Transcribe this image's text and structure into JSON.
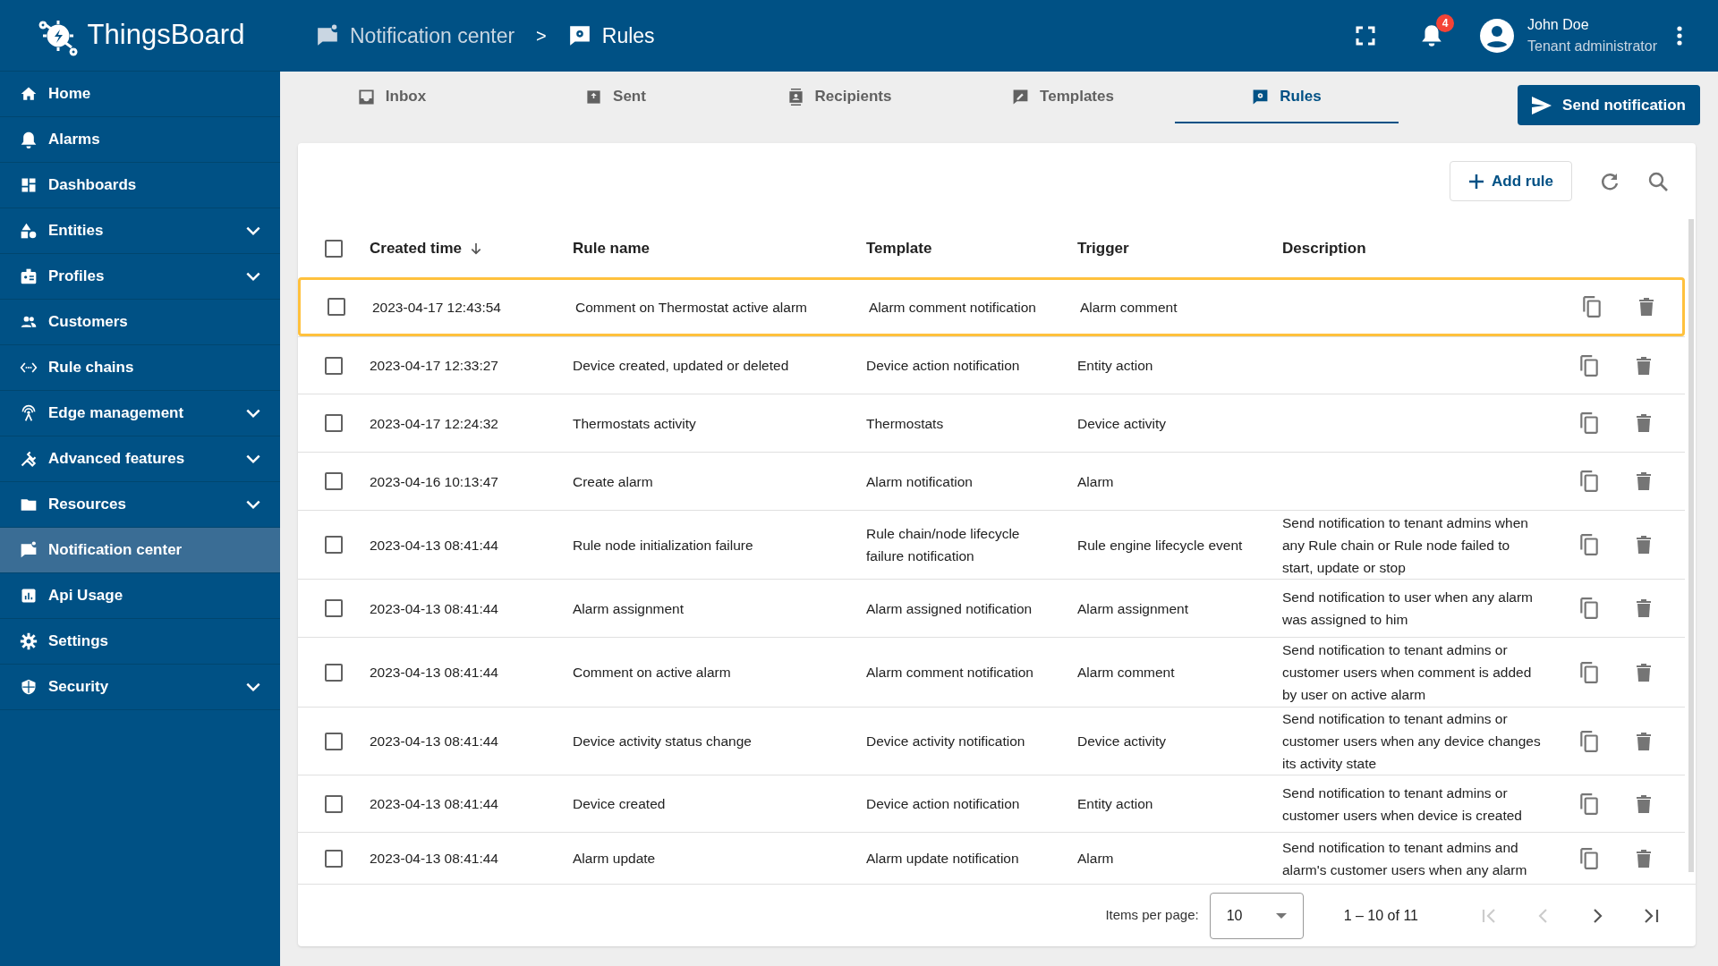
{
  "app": {
    "logo": "ThingsBoard"
  },
  "breadcrumb": [
    {
      "label": "Notification center",
      "current": false
    },
    {
      "label": "Rules",
      "current": true
    }
  ],
  "breadcrumb_separator": ">",
  "notifications": {
    "badge": "4"
  },
  "user": {
    "name": "John Doe",
    "role": "Tenant administrator"
  },
  "sidebar": {
    "items": [
      {
        "label": "Home",
        "expandable": false,
        "selected": false
      },
      {
        "label": "Alarms",
        "expandable": false,
        "selected": false
      },
      {
        "label": "Dashboards",
        "expandable": false,
        "selected": false
      },
      {
        "label": "Entities",
        "expandable": true,
        "selected": false
      },
      {
        "label": "Profiles",
        "expandable": true,
        "selected": false
      },
      {
        "label": "Customers",
        "expandable": false,
        "selected": false
      },
      {
        "label": "Rule chains",
        "expandable": false,
        "selected": false
      },
      {
        "label": "Edge management",
        "expandable": true,
        "selected": false
      },
      {
        "label": "Advanced features",
        "expandable": true,
        "selected": false
      },
      {
        "label": "Resources",
        "expandable": true,
        "selected": false
      },
      {
        "label": "Notification center",
        "expandable": false,
        "selected": true
      },
      {
        "label": "Api Usage",
        "expandable": false,
        "selected": false
      },
      {
        "label": "Settings",
        "expandable": false,
        "selected": false
      },
      {
        "label": "Security",
        "expandable": true,
        "selected": false
      }
    ]
  },
  "tabs": [
    {
      "label": "Inbox",
      "selected": false
    },
    {
      "label": "Sent",
      "selected": false
    },
    {
      "label": "Recipients",
      "selected": false
    },
    {
      "label": "Templates",
      "selected": false
    },
    {
      "label": "Rules",
      "selected": true
    }
  ],
  "send_button": "Send notification",
  "toolbar": {
    "add_button": "Add rule"
  },
  "table": {
    "select_all": {
      "checked": false
    },
    "columns": [
      "Created time",
      "Rule name",
      "Template",
      "Trigger",
      "Description"
    ],
    "rows": [
      {
        "checked": false,
        "highlighted": true,
        "cells": [
          "2023-04-17 12:43:54",
          "Comment on Thermostat active alarm",
          "Alarm comment notification",
          "Alarm comment",
          ""
        ]
      },
      {
        "checked": false,
        "highlighted": false,
        "cells": [
          "2023-04-17 12:33:27",
          "Device created, updated or deleted",
          "Device action notification",
          "Entity action",
          ""
        ]
      },
      {
        "checked": false,
        "highlighted": false,
        "cells": [
          "2023-04-17 12:24:32",
          "Thermostats activity",
          "Thermostats",
          "Device activity",
          ""
        ]
      },
      {
        "checked": false,
        "highlighted": false,
        "cells": [
          "2023-04-16 10:13:47",
          "Create alarm",
          "Alarm notification",
          "Alarm",
          ""
        ]
      },
      {
        "checked": false,
        "highlighted": false,
        "cells": [
          "2023-04-13 08:41:44",
          "Rule node initialization failure",
          "Rule chain/node lifecycle failure notification",
          "Rule engine lifecycle event",
          "Send notification to tenant admins when any Rule chain or Rule node failed to start, update or stop"
        ]
      },
      {
        "checked": false,
        "highlighted": false,
        "cells": [
          "2023-04-13 08:41:44",
          "Alarm assignment",
          "Alarm assigned notification",
          "Alarm assignment",
          "Send notification to user when any alarm was assigned to him"
        ]
      },
      {
        "checked": false,
        "highlighted": false,
        "cells": [
          "2023-04-13 08:41:44",
          "Comment on active alarm",
          "Alarm comment notification",
          "Alarm comment",
          "Send notification to tenant admins or customer users when comment is added by user on active alarm"
        ]
      },
      {
        "checked": false,
        "highlighted": false,
        "cells": [
          "2023-04-13 08:41:44",
          "Device activity status change",
          "Device activity notification",
          "Device activity",
          "Send notification to tenant admins or customer users when any device changes its activity state"
        ]
      },
      {
        "checked": false,
        "highlighted": false,
        "cells": [
          "2023-04-13 08:41:44",
          "Device created",
          "Device action notification",
          "Entity action",
          "Send notification to tenant admins or customer users when device is created"
        ]
      },
      {
        "checked": false,
        "highlighted": false,
        "cells": [
          "2023-04-13 08:41:44",
          "Alarm update",
          "Alarm update notification",
          "Alarm",
          "Send notification to tenant admins and alarm's customer users when any alarm"
        ]
      }
    ]
  },
  "paginator": {
    "label": "Items per page:",
    "page_size": "10",
    "range": "1 – 10 of 11"
  }
}
